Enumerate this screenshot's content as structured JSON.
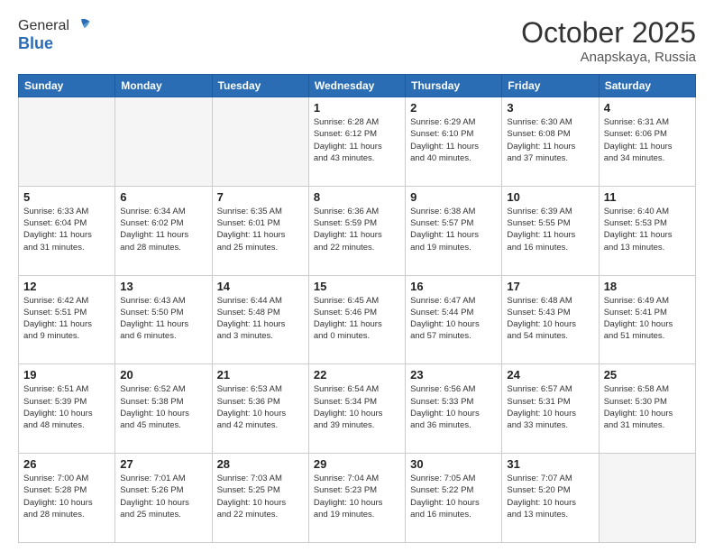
{
  "header": {
    "logo_line1": "General",
    "logo_line2": "Blue",
    "month_title": "October 2025",
    "location": "Anapskaya, Russia"
  },
  "weekdays": [
    "Sunday",
    "Monday",
    "Tuesday",
    "Wednesday",
    "Thursday",
    "Friday",
    "Saturday"
  ],
  "weeks": [
    [
      {
        "day": "",
        "info": ""
      },
      {
        "day": "",
        "info": ""
      },
      {
        "day": "",
        "info": ""
      },
      {
        "day": "1",
        "info": "Sunrise: 6:28 AM\nSunset: 6:12 PM\nDaylight: 11 hours\nand 43 minutes."
      },
      {
        "day": "2",
        "info": "Sunrise: 6:29 AM\nSunset: 6:10 PM\nDaylight: 11 hours\nand 40 minutes."
      },
      {
        "day": "3",
        "info": "Sunrise: 6:30 AM\nSunset: 6:08 PM\nDaylight: 11 hours\nand 37 minutes."
      },
      {
        "day": "4",
        "info": "Sunrise: 6:31 AM\nSunset: 6:06 PM\nDaylight: 11 hours\nand 34 minutes."
      }
    ],
    [
      {
        "day": "5",
        "info": "Sunrise: 6:33 AM\nSunset: 6:04 PM\nDaylight: 11 hours\nand 31 minutes."
      },
      {
        "day": "6",
        "info": "Sunrise: 6:34 AM\nSunset: 6:02 PM\nDaylight: 11 hours\nand 28 minutes."
      },
      {
        "day": "7",
        "info": "Sunrise: 6:35 AM\nSunset: 6:01 PM\nDaylight: 11 hours\nand 25 minutes."
      },
      {
        "day": "8",
        "info": "Sunrise: 6:36 AM\nSunset: 5:59 PM\nDaylight: 11 hours\nand 22 minutes."
      },
      {
        "day": "9",
        "info": "Sunrise: 6:38 AM\nSunset: 5:57 PM\nDaylight: 11 hours\nand 19 minutes."
      },
      {
        "day": "10",
        "info": "Sunrise: 6:39 AM\nSunset: 5:55 PM\nDaylight: 11 hours\nand 16 minutes."
      },
      {
        "day": "11",
        "info": "Sunrise: 6:40 AM\nSunset: 5:53 PM\nDaylight: 11 hours\nand 13 minutes."
      }
    ],
    [
      {
        "day": "12",
        "info": "Sunrise: 6:42 AM\nSunset: 5:51 PM\nDaylight: 11 hours\nand 9 minutes."
      },
      {
        "day": "13",
        "info": "Sunrise: 6:43 AM\nSunset: 5:50 PM\nDaylight: 11 hours\nand 6 minutes."
      },
      {
        "day": "14",
        "info": "Sunrise: 6:44 AM\nSunset: 5:48 PM\nDaylight: 11 hours\nand 3 minutes."
      },
      {
        "day": "15",
        "info": "Sunrise: 6:45 AM\nSunset: 5:46 PM\nDaylight: 11 hours\nand 0 minutes."
      },
      {
        "day": "16",
        "info": "Sunrise: 6:47 AM\nSunset: 5:44 PM\nDaylight: 10 hours\nand 57 minutes."
      },
      {
        "day": "17",
        "info": "Sunrise: 6:48 AM\nSunset: 5:43 PM\nDaylight: 10 hours\nand 54 minutes."
      },
      {
        "day": "18",
        "info": "Sunrise: 6:49 AM\nSunset: 5:41 PM\nDaylight: 10 hours\nand 51 minutes."
      }
    ],
    [
      {
        "day": "19",
        "info": "Sunrise: 6:51 AM\nSunset: 5:39 PM\nDaylight: 10 hours\nand 48 minutes."
      },
      {
        "day": "20",
        "info": "Sunrise: 6:52 AM\nSunset: 5:38 PM\nDaylight: 10 hours\nand 45 minutes."
      },
      {
        "day": "21",
        "info": "Sunrise: 6:53 AM\nSunset: 5:36 PM\nDaylight: 10 hours\nand 42 minutes."
      },
      {
        "day": "22",
        "info": "Sunrise: 6:54 AM\nSunset: 5:34 PM\nDaylight: 10 hours\nand 39 minutes."
      },
      {
        "day": "23",
        "info": "Sunrise: 6:56 AM\nSunset: 5:33 PM\nDaylight: 10 hours\nand 36 minutes."
      },
      {
        "day": "24",
        "info": "Sunrise: 6:57 AM\nSunset: 5:31 PM\nDaylight: 10 hours\nand 33 minutes."
      },
      {
        "day": "25",
        "info": "Sunrise: 6:58 AM\nSunset: 5:30 PM\nDaylight: 10 hours\nand 31 minutes."
      }
    ],
    [
      {
        "day": "26",
        "info": "Sunrise: 7:00 AM\nSunset: 5:28 PM\nDaylight: 10 hours\nand 28 minutes."
      },
      {
        "day": "27",
        "info": "Sunrise: 7:01 AM\nSunset: 5:26 PM\nDaylight: 10 hours\nand 25 minutes."
      },
      {
        "day": "28",
        "info": "Sunrise: 7:03 AM\nSunset: 5:25 PM\nDaylight: 10 hours\nand 22 minutes."
      },
      {
        "day": "29",
        "info": "Sunrise: 7:04 AM\nSunset: 5:23 PM\nDaylight: 10 hours\nand 19 minutes."
      },
      {
        "day": "30",
        "info": "Sunrise: 7:05 AM\nSunset: 5:22 PM\nDaylight: 10 hours\nand 16 minutes."
      },
      {
        "day": "31",
        "info": "Sunrise: 7:07 AM\nSunset: 5:20 PM\nDaylight: 10 hours\nand 13 minutes."
      },
      {
        "day": "",
        "info": ""
      }
    ]
  ]
}
